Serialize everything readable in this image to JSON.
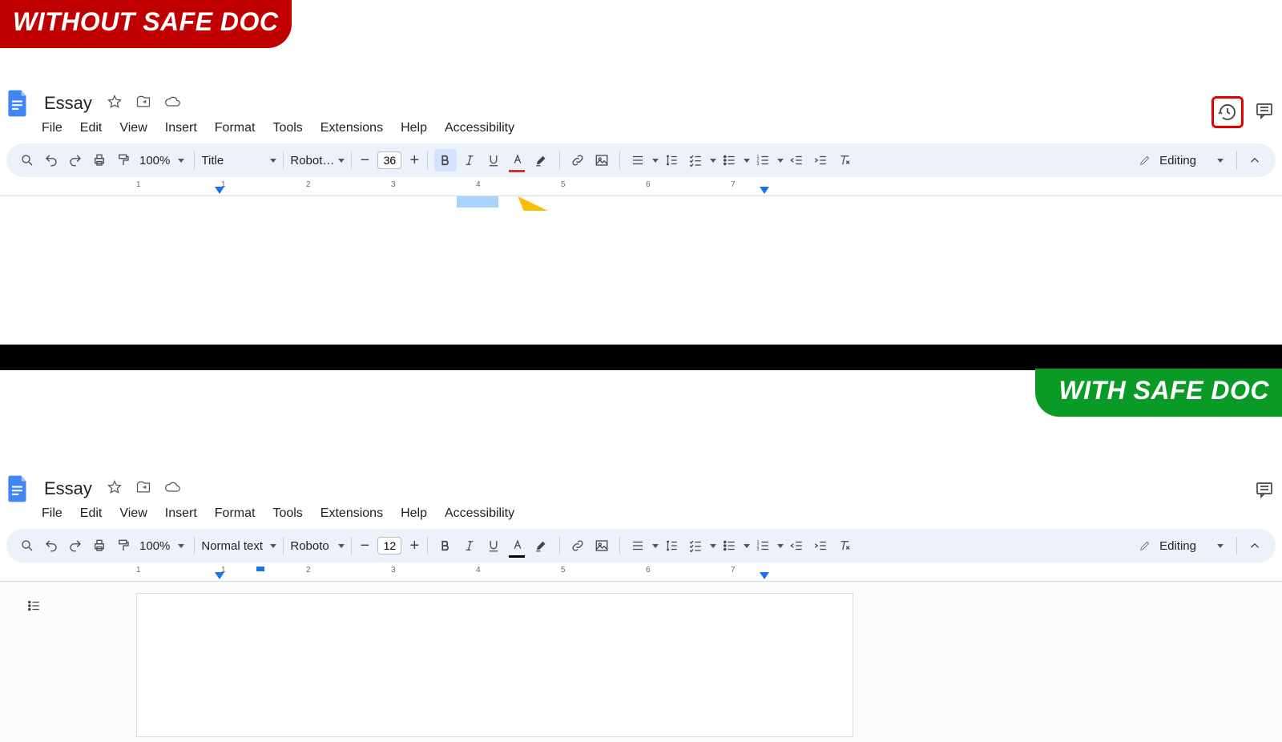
{
  "badges": {
    "without": "WITHOUT SAFE DOC",
    "with": "WITH SAFE DOC"
  },
  "pane1": {
    "doc_name": "Essay",
    "menus": [
      "File",
      "Edit",
      "View",
      "Insert",
      "Format",
      "Tools",
      "Extensions",
      "Help",
      "Accessibility"
    ],
    "zoom": "100%",
    "style": "Title",
    "font": "Robot…",
    "font_size": "36",
    "mode": "Editing",
    "ruler_numbers": [
      "1",
      "1",
      "2",
      "3",
      "4",
      "5",
      "6",
      "7"
    ],
    "history_highlighted": true
  },
  "pane2": {
    "doc_name": "Essay",
    "menus": [
      "File",
      "Edit",
      "View",
      "Insert",
      "Format",
      "Tools",
      "Extensions",
      "Help",
      "Accessibility"
    ],
    "zoom": "100%",
    "style": "Normal text",
    "font": "Roboto",
    "font_size": "12",
    "mode": "Editing",
    "ruler_numbers": [
      "1",
      "1",
      "2",
      "3",
      "4",
      "5",
      "6",
      "7"
    ],
    "history_highlighted": false
  },
  "colors": {
    "badge_red": "#c00000",
    "badge_green": "#0a9b27",
    "highlight_border": "#e80000",
    "text_color_marker": "#d93025"
  }
}
